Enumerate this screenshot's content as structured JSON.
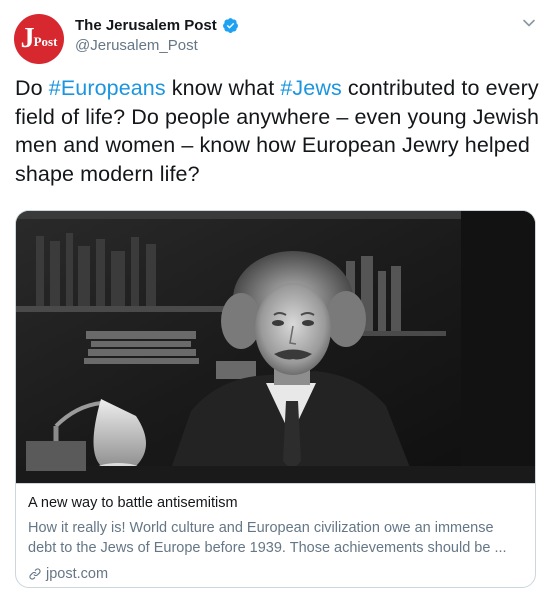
{
  "author": {
    "display_name": "The Jerusalem Post",
    "handle": "@Jerusalem_Post",
    "avatar_logo": "JPost"
  },
  "tweet": {
    "text_parts": [
      {
        "text": "Do ",
        "type": "plain"
      },
      {
        "text": "#Europeans",
        "type": "hashtag"
      },
      {
        "text": " know what ",
        "type": "plain"
      },
      {
        "text": "#Jews",
        "type": "hashtag"
      },
      {
        "text": " contributed to every field of life? Do people anywhere – even young Jewish men and women – know how European Jewry helped shape modern life?",
        "type": "plain"
      }
    ]
  },
  "card": {
    "title": "A new way to battle antisemitism",
    "description": "How it really is! World culture and European civilization owe an immense debt to the Jews of Europe before 1939. Those achievements should be ...",
    "domain": "jpost.com",
    "image_subject": "vintage black and white portrait photo"
  },
  "colors": {
    "brand_red": "#d7282f",
    "hashtag_blue": "#1b95e0",
    "verified_blue": "#1da1f2",
    "secondary_text": "#657786"
  },
  "icons": [
    "verified-badge-icon",
    "chevron-down-icon",
    "link-icon"
  ]
}
